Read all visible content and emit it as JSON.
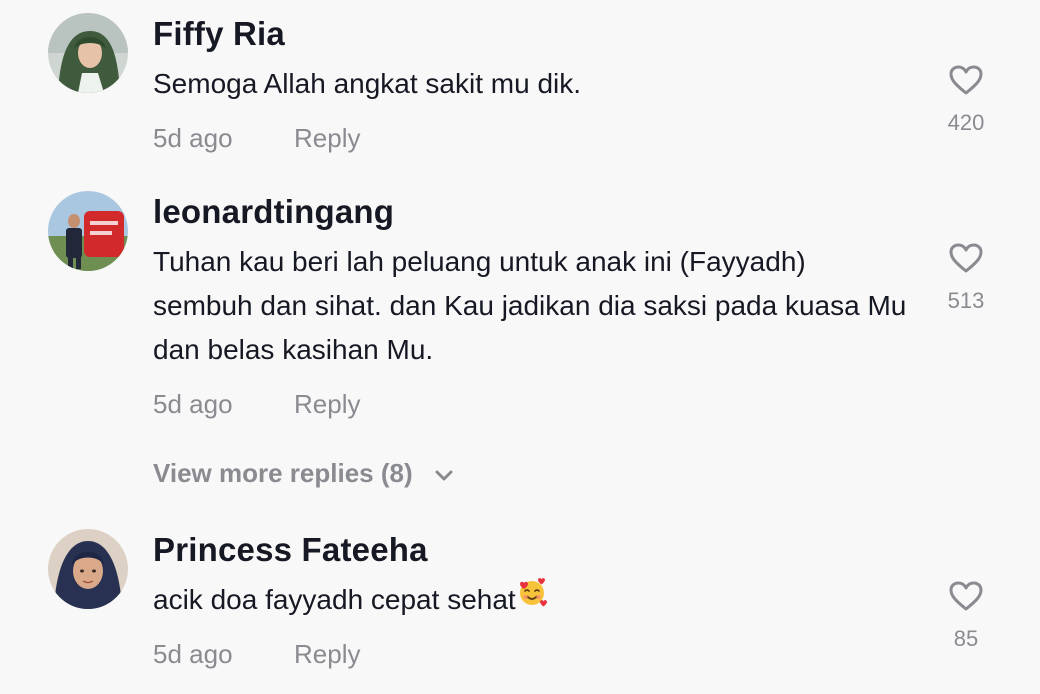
{
  "comments": [
    {
      "username": "Fiffy Ria",
      "text": "Semoga Allah angkat sakit mu dik.",
      "time": "5d ago",
      "reply_label": "Reply",
      "likes": "420",
      "avatar_icon": "avatar-hijab-green"
    },
    {
      "username": "leonardtingang",
      "text": "Tuhan kau beri lah peluang untuk anak ini (Fayyadh) sembuh dan sihat. dan Kau jadikan dia saksi pada kuasa Mu dan belas kasihan Mu.",
      "time": "5d ago",
      "reply_label": "Reply",
      "likes": "513",
      "avatar_icon": "avatar-man-red-sign"
    },
    {
      "username": "Princess Fateeha",
      "text": "acik doa fayyadh cepat sehat",
      "emoji": "smiling-face-with-hearts",
      "time": "5d ago",
      "reply_label": "Reply",
      "likes": "85",
      "avatar_icon": "avatar-hijab-navy"
    }
  ],
  "view_more_replies": "View more replies (8)",
  "colors": {
    "background": "#f8f8f8",
    "username": "#161823",
    "secondary": "#8a8b91"
  }
}
